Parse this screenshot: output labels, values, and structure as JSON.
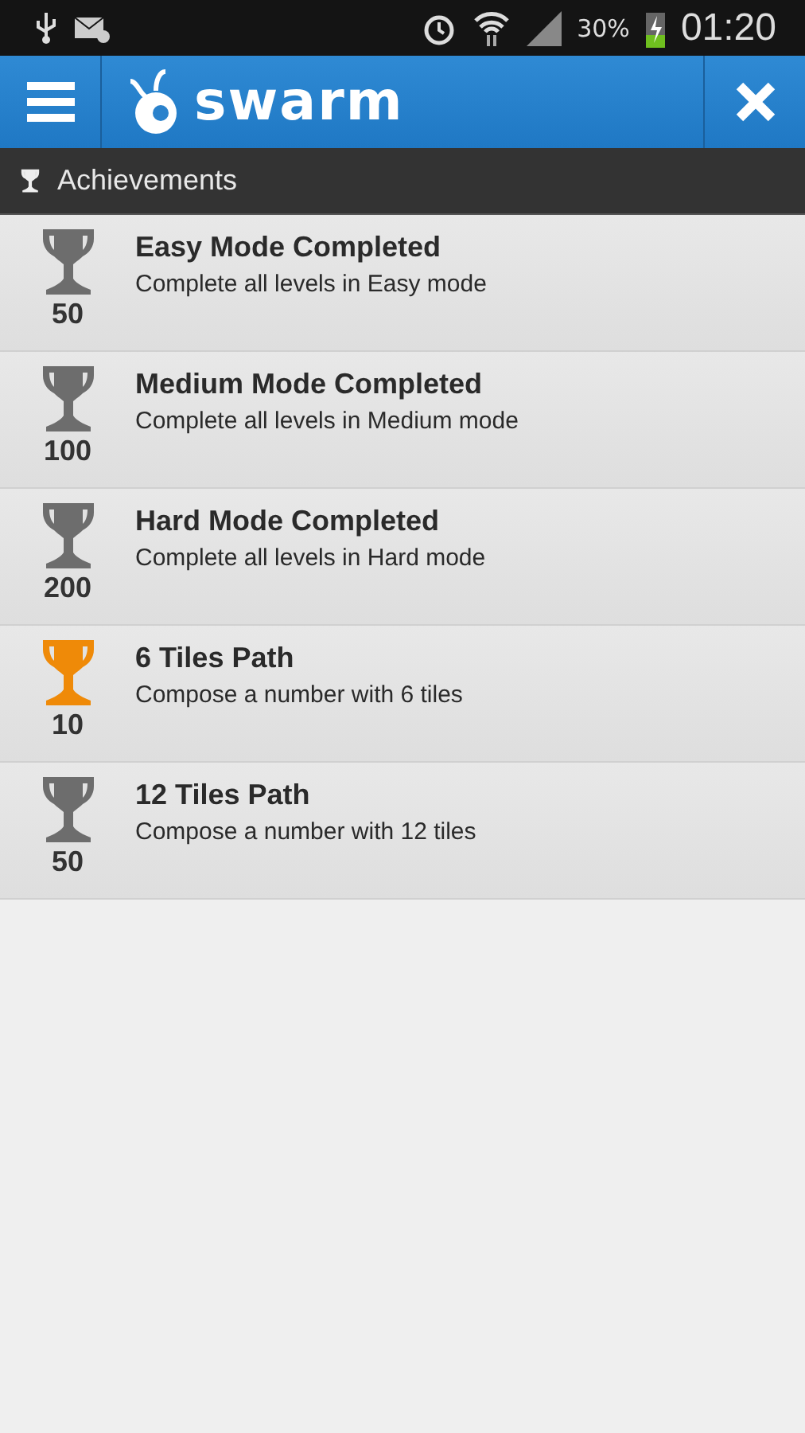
{
  "status_bar": {
    "battery": "30%",
    "time": "01:20"
  },
  "app_bar": {
    "logo": "swarm"
  },
  "section": {
    "title": "Achievements"
  },
  "achievements": [
    {
      "title": "Easy Mode Completed",
      "description": "Complete all levels in Easy mode",
      "points": "50",
      "unlocked": false
    },
    {
      "title": "Medium Mode Completed",
      "description": "Complete all levels in Medium mode",
      "points": "100",
      "unlocked": false
    },
    {
      "title": "Hard Mode Completed",
      "description": "Complete all levels in Hard mode",
      "points": "200",
      "unlocked": false
    },
    {
      "title": "6 Tiles Path",
      "description": "Compose a number with 6 tiles",
      "points": "10",
      "unlocked": true
    },
    {
      "title": "12 Tiles Path",
      "description": "Compose a number with 12 tiles",
      "points": "50",
      "unlocked": false
    }
  ]
}
